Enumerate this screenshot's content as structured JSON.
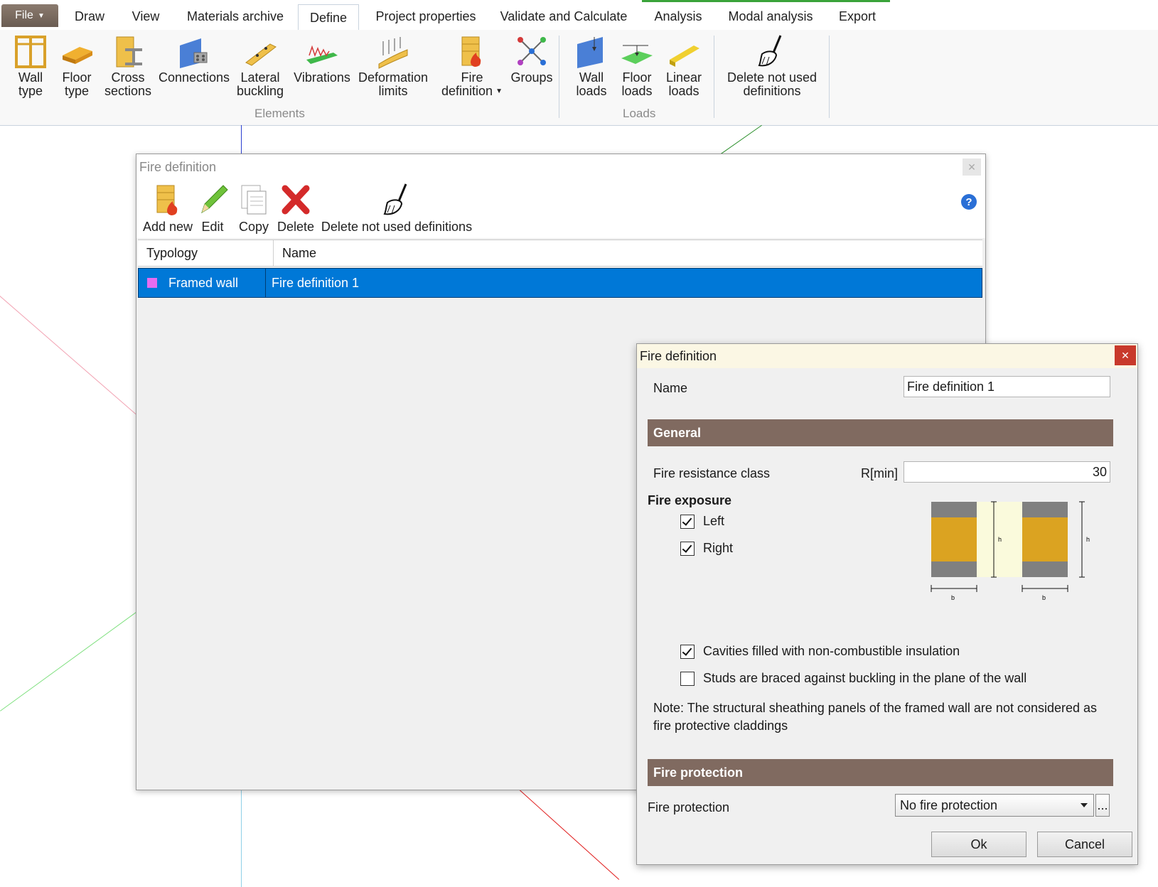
{
  "menu": {
    "file_label": "File",
    "tabs": [
      "Draw",
      "View",
      "Materials archive",
      "Define",
      "Project properties",
      "Validate and Calculate",
      "Analysis",
      "Modal analysis",
      "Export"
    ],
    "active_tab": "Define"
  },
  "ribbon": {
    "elements": [
      {
        "line1": "Wall",
        "line2": "type",
        "icon": "wall-type-icon"
      },
      {
        "line1": "Floor",
        "line2": "type",
        "icon": "floor-type-icon"
      },
      {
        "line1": "Cross",
        "line2": "sections",
        "icon": "cross-sections-icon"
      },
      {
        "line1": "Connections",
        "line2": "",
        "icon": "connections-icon"
      },
      {
        "line1": "Lateral",
        "line2": "buckling",
        "icon": "lateral-buckling-icon"
      },
      {
        "line1": "Vibrations",
        "line2": "",
        "icon": "vibrations-icon"
      },
      {
        "line1": "Deformation",
        "line2": "limits",
        "icon": "deformation-limits-icon"
      },
      {
        "line1": "Fire",
        "line2": "definition",
        "icon": "fire-definition-icon"
      },
      {
        "line1": "Groups",
        "line2": "",
        "icon": "groups-icon"
      }
    ],
    "elements_group_label": "Elements",
    "loads": [
      {
        "line1": "Wall",
        "line2": "loads",
        "icon": "wall-loads-icon"
      },
      {
        "line1": "Floor",
        "line2": "loads",
        "icon": "floor-loads-icon"
      },
      {
        "line1": "Linear",
        "line2": "loads",
        "icon": "linear-loads-icon"
      }
    ],
    "loads_group_label": "Loads",
    "delete_unused": {
      "line1": "Delete not used",
      "line2": "definitions",
      "icon": "broom-icon"
    }
  },
  "list_window": {
    "title": "Fire definition",
    "toolbar": {
      "add_new": "Add new",
      "edit": "Edit",
      "copy": "Copy",
      "delete": "Delete",
      "delete_unused": "Delete not used definitions"
    },
    "help": "?",
    "columns": [
      "Typology",
      "Name"
    ],
    "rows": [
      {
        "typology": "Framed wall",
        "name": "Fire definition 1",
        "color": "#e86cf0"
      }
    ]
  },
  "dialog": {
    "title": "Fire definition",
    "name_label": "Name",
    "name_value": "Fire definition 1",
    "general_header": "General",
    "fire_resistance_label": "Fire resistance class",
    "fire_resistance_unit": "R[min]",
    "fire_resistance_value": "30",
    "fire_exposure_label": "Fire exposure",
    "exposure_left": {
      "label": "Left",
      "checked": true
    },
    "exposure_right": {
      "label": "Right",
      "checked": true
    },
    "diagram": {
      "dim_h": "h",
      "dim_b": "b"
    },
    "cavities": {
      "label": "Cavities filled with non-combustible insulation",
      "checked": true
    },
    "studs_braced": {
      "label": "Studs are braced against buckling in the plane of the wall",
      "checked": false
    },
    "note": "Note: The structural sheathing panels of the framed wall are not considered as fire protective claddings",
    "fire_protection_header": "Fire protection",
    "fire_protection_label": "Fire protection",
    "fire_protection_value": "No fire protection",
    "browse_label": "...",
    "ok_label": "Ok",
    "cancel_label": "Cancel"
  },
  "colors": {
    "section_header": "#806a60",
    "selection": "#0078d7",
    "dialog_title": "#fbf7e4",
    "close_button": "#c8392b",
    "wood": "#dba321"
  }
}
